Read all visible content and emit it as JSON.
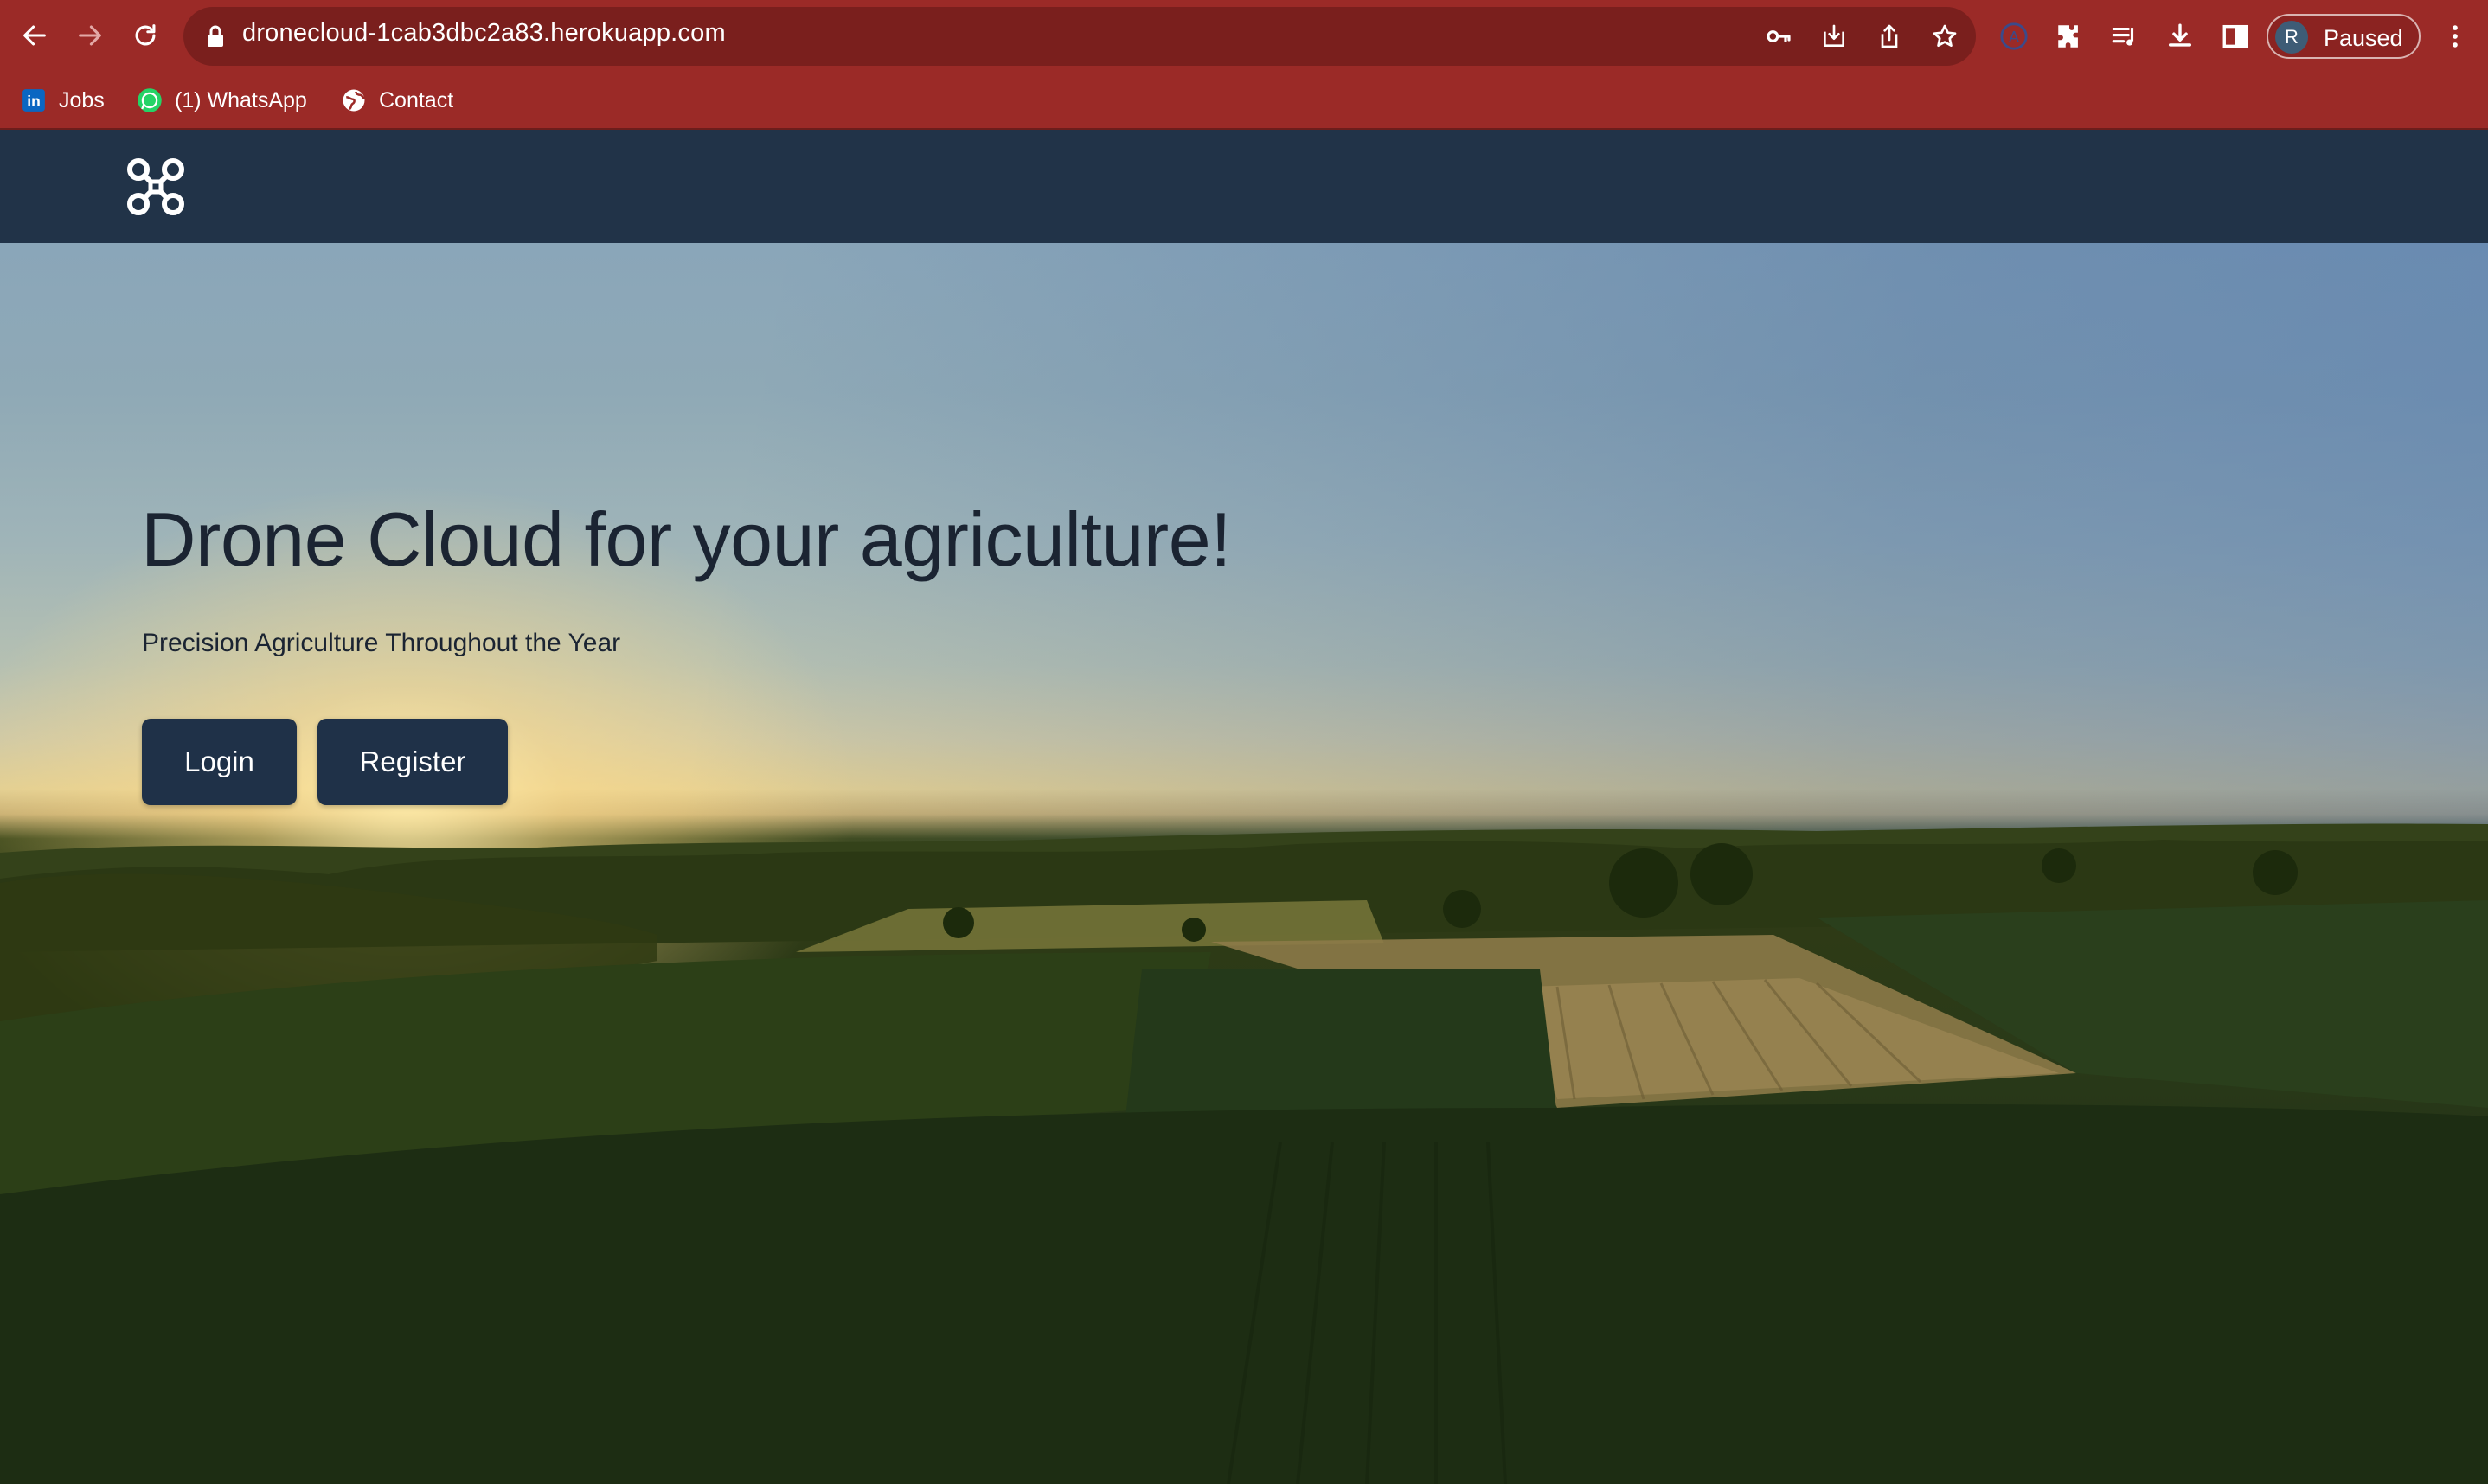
{
  "browser": {
    "url": "dronecloud-1cab3dbc2a83.herokuapp.com",
    "profile_initial": "R",
    "profile_status": "Paused",
    "bookmarks": [
      {
        "label": "Jobs",
        "icon": "linkedin-icon"
      },
      {
        "label": "(1) WhatsApp",
        "icon": "whatsapp-icon"
      },
      {
        "label": "Contact",
        "icon": "globe-icon"
      }
    ],
    "colors": {
      "frame": "#9b2a27",
      "omnibox": "#7a1f1d"
    }
  },
  "site": {
    "logo_icon": "drone-icon",
    "nav_color": "#213348"
  },
  "hero": {
    "title": "Drone Cloud for your agriculture!",
    "subtitle": "Precision Agriculture Throughout the Year",
    "login_label": "Login",
    "register_label": "Register",
    "button_color": "#1f3148"
  }
}
